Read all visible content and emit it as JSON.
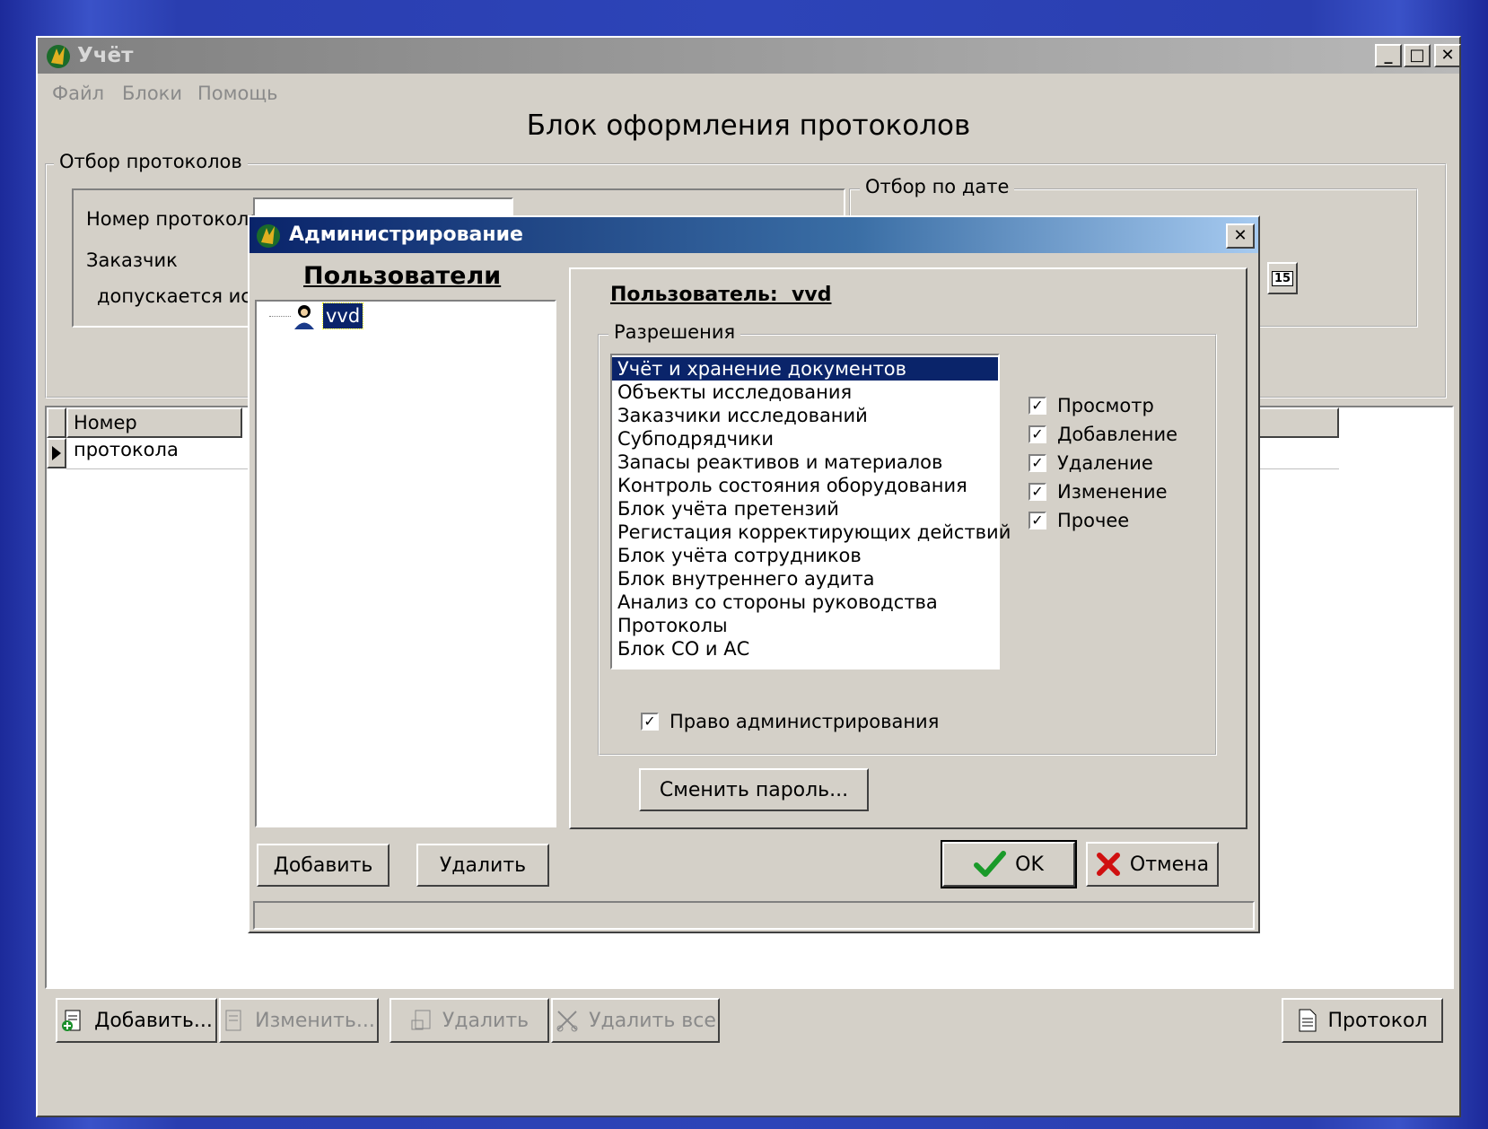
{
  "main_window": {
    "title": "Учёт",
    "menu": [
      "Файл",
      "Блоки",
      "Помощь"
    ],
    "heading": "Блок оформления протоколов",
    "filter_group": "Отбор протоколов",
    "label_protocol_number": "Номер протокола",
    "label_customer": "Заказчик",
    "label_allowed": "допускается исп",
    "date_group": "Отбор по дате",
    "calendar_icon_text": "15",
    "grid_column_header": "Номер протокола",
    "buttons": {
      "add": "Добавить...",
      "edit": "Изменить...",
      "delete": "Удалить",
      "delete_all": "Удалить все",
      "protocol": "Протокол"
    }
  },
  "dialog": {
    "title": "Администрирование",
    "users_heading": "Пользователи",
    "users": [
      "vvd"
    ],
    "user_label": "Пользователь:  vvd",
    "permissions_group": "Разрешения",
    "modules": [
      "Учёт и хранение документов",
      "Объекты исследования",
      "Заказчики исследований",
      "Субподрядчики",
      "Запасы реактивов и материалов",
      "Контроль состояния оборудования",
      "Блок учёта претензий",
      "Регистация корректирующих действий",
      "Блок учёта сотрудников",
      "Блок внутреннего аудита",
      "Анализ со стороны руководства",
      "Протоколы",
      "Блок СО и АС"
    ],
    "selected_module_index": 0,
    "permissions": {
      "view": "Просмотр",
      "add": "Добавление",
      "delete": "Удаление",
      "edit": "Изменение",
      "other": "Прочее"
    },
    "admin_right": "Право администрирования",
    "change_password": "Сменить пароль...",
    "add_user": "Добавить",
    "delete_user": "Удалить",
    "ok": "OK",
    "cancel": "Отмена"
  },
  "colors": {
    "title_active": "#0a246a",
    "title_inactive": "#808080",
    "face": "#d4d0c8",
    "selection": "#0a246a"
  }
}
